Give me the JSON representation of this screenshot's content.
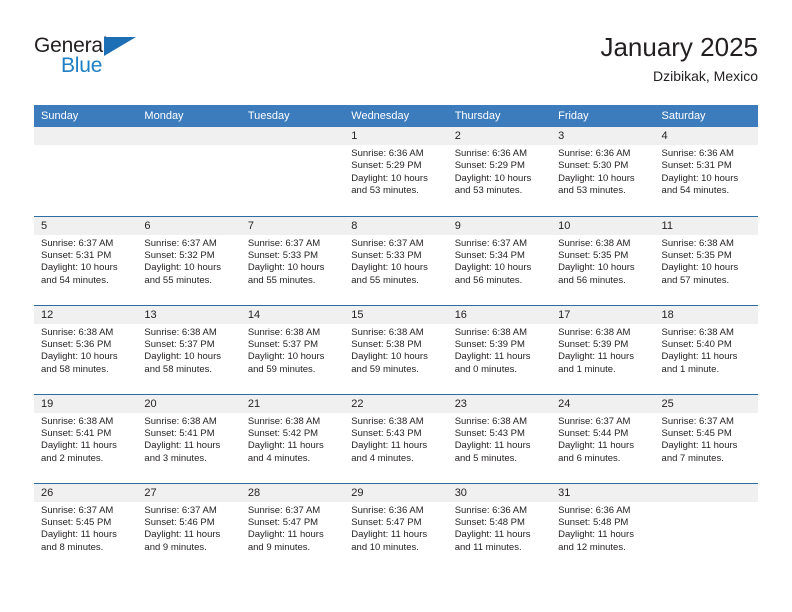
{
  "brand": {
    "name_top": "General",
    "name_bottom": "Blue",
    "accent_color": "#1d6fb5"
  },
  "header": {
    "title": "January 2025",
    "subtitle": "Dzibikak, Mexico"
  },
  "theme": {
    "header_row_bg": "#3c7cbd",
    "row_divider": "#2e6da4",
    "daynum_band_bg": "#f0f0f0",
    "text": "#231f20"
  },
  "weekday_headers": [
    "Sunday",
    "Monday",
    "Tuesday",
    "Wednesday",
    "Thursday",
    "Friday",
    "Saturday"
  ],
  "weeks": [
    [
      {
        "day": "",
        "lines": []
      },
      {
        "day": "",
        "lines": []
      },
      {
        "day": "",
        "lines": []
      },
      {
        "day": "1",
        "lines": [
          "Sunrise: 6:36 AM",
          "Sunset: 5:29 PM",
          "Daylight: 10 hours",
          "and 53 minutes."
        ]
      },
      {
        "day": "2",
        "lines": [
          "Sunrise: 6:36 AM",
          "Sunset: 5:29 PM",
          "Daylight: 10 hours",
          "and 53 minutes."
        ]
      },
      {
        "day": "3",
        "lines": [
          "Sunrise: 6:36 AM",
          "Sunset: 5:30 PM",
          "Daylight: 10 hours",
          "and 53 minutes."
        ]
      },
      {
        "day": "4",
        "lines": [
          "Sunrise: 6:36 AM",
          "Sunset: 5:31 PM",
          "Daylight: 10 hours",
          "and 54 minutes."
        ]
      }
    ],
    [
      {
        "day": "5",
        "lines": [
          "Sunrise: 6:37 AM",
          "Sunset: 5:31 PM",
          "Daylight: 10 hours",
          "and 54 minutes."
        ]
      },
      {
        "day": "6",
        "lines": [
          "Sunrise: 6:37 AM",
          "Sunset: 5:32 PM",
          "Daylight: 10 hours",
          "and 55 minutes."
        ]
      },
      {
        "day": "7",
        "lines": [
          "Sunrise: 6:37 AM",
          "Sunset: 5:33 PM",
          "Daylight: 10 hours",
          "and 55 minutes."
        ]
      },
      {
        "day": "8",
        "lines": [
          "Sunrise: 6:37 AM",
          "Sunset: 5:33 PM",
          "Daylight: 10 hours",
          "and 55 minutes."
        ]
      },
      {
        "day": "9",
        "lines": [
          "Sunrise: 6:37 AM",
          "Sunset: 5:34 PM",
          "Daylight: 10 hours",
          "and 56 minutes."
        ]
      },
      {
        "day": "10",
        "lines": [
          "Sunrise: 6:38 AM",
          "Sunset: 5:35 PM",
          "Daylight: 10 hours",
          "and 56 minutes."
        ]
      },
      {
        "day": "11",
        "lines": [
          "Sunrise: 6:38 AM",
          "Sunset: 5:35 PM",
          "Daylight: 10 hours",
          "and 57 minutes."
        ]
      }
    ],
    [
      {
        "day": "12",
        "lines": [
          "Sunrise: 6:38 AM",
          "Sunset: 5:36 PM",
          "Daylight: 10 hours",
          "and 58 minutes."
        ]
      },
      {
        "day": "13",
        "lines": [
          "Sunrise: 6:38 AM",
          "Sunset: 5:37 PM",
          "Daylight: 10 hours",
          "and 58 minutes."
        ]
      },
      {
        "day": "14",
        "lines": [
          "Sunrise: 6:38 AM",
          "Sunset: 5:37 PM",
          "Daylight: 10 hours",
          "and 59 minutes."
        ]
      },
      {
        "day": "15",
        "lines": [
          "Sunrise: 6:38 AM",
          "Sunset: 5:38 PM",
          "Daylight: 10 hours",
          "and 59 minutes."
        ]
      },
      {
        "day": "16",
        "lines": [
          "Sunrise: 6:38 AM",
          "Sunset: 5:39 PM",
          "Daylight: 11 hours",
          "and 0 minutes."
        ]
      },
      {
        "day": "17",
        "lines": [
          "Sunrise: 6:38 AM",
          "Sunset: 5:39 PM",
          "Daylight: 11 hours",
          "and 1 minute."
        ]
      },
      {
        "day": "18",
        "lines": [
          "Sunrise: 6:38 AM",
          "Sunset: 5:40 PM",
          "Daylight: 11 hours",
          "and 1 minute."
        ]
      }
    ],
    [
      {
        "day": "19",
        "lines": [
          "Sunrise: 6:38 AM",
          "Sunset: 5:41 PM",
          "Daylight: 11 hours",
          "and 2 minutes."
        ]
      },
      {
        "day": "20",
        "lines": [
          "Sunrise: 6:38 AM",
          "Sunset: 5:41 PM",
          "Daylight: 11 hours",
          "and 3 minutes."
        ]
      },
      {
        "day": "21",
        "lines": [
          "Sunrise: 6:38 AM",
          "Sunset: 5:42 PM",
          "Daylight: 11 hours",
          "and 4 minutes."
        ]
      },
      {
        "day": "22",
        "lines": [
          "Sunrise: 6:38 AM",
          "Sunset: 5:43 PM",
          "Daylight: 11 hours",
          "and 4 minutes."
        ]
      },
      {
        "day": "23",
        "lines": [
          "Sunrise: 6:38 AM",
          "Sunset: 5:43 PM",
          "Daylight: 11 hours",
          "and 5 minutes."
        ]
      },
      {
        "day": "24",
        "lines": [
          "Sunrise: 6:37 AM",
          "Sunset: 5:44 PM",
          "Daylight: 11 hours",
          "and 6 minutes."
        ]
      },
      {
        "day": "25",
        "lines": [
          "Sunrise: 6:37 AM",
          "Sunset: 5:45 PM",
          "Daylight: 11 hours",
          "and 7 minutes."
        ]
      }
    ],
    [
      {
        "day": "26",
        "lines": [
          "Sunrise: 6:37 AM",
          "Sunset: 5:45 PM",
          "Daylight: 11 hours",
          "and 8 minutes."
        ]
      },
      {
        "day": "27",
        "lines": [
          "Sunrise: 6:37 AM",
          "Sunset: 5:46 PM",
          "Daylight: 11 hours",
          "and 9 minutes."
        ]
      },
      {
        "day": "28",
        "lines": [
          "Sunrise: 6:37 AM",
          "Sunset: 5:47 PM",
          "Daylight: 11 hours",
          "and 9 minutes."
        ]
      },
      {
        "day": "29",
        "lines": [
          "Sunrise: 6:36 AM",
          "Sunset: 5:47 PM",
          "Daylight: 11 hours",
          "and 10 minutes."
        ]
      },
      {
        "day": "30",
        "lines": [
          "Sunrise: 6:36 AM",
          "Sunset: 5:48 PM",
          "Daylight: 11 hours",
          "and 11 minutes."
        ]
      },
      {
        "day": "31",
        "lines": [
          "Sunrise: 6:36 AM",
          "Sunset: 5:48 PM",
          "Daylight: 11 hours",
          "and 12 minutes."
        ]
      },
      {
        "day": "",
        "lines": []
      }
    ]
  ]
}
